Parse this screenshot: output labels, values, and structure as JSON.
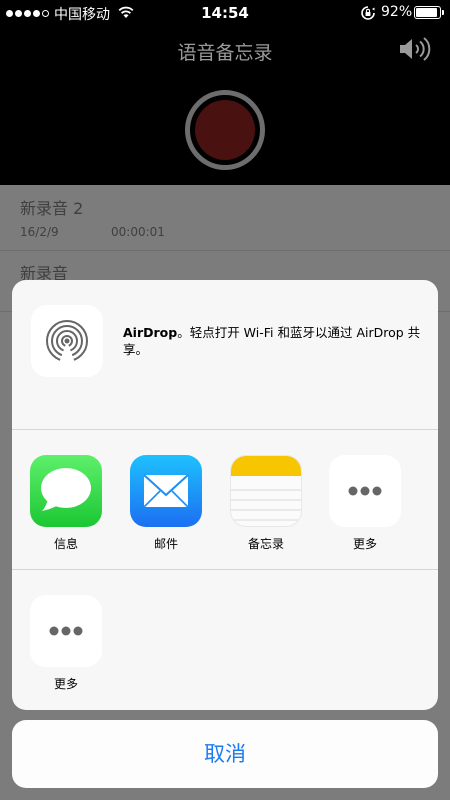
{
  "status_bar": {
    "carrier": "中国移动",
    "time": "14:54",
    "battery": "92%",
    "battery_level": 0.92
  },
  "header": {
    "title": "语音备忘录"
  },
  "recordings": [
    {
      "title": "新录音 2",
      "date": "16/2/9",
      "duration": "00:00:01"
    },
    {
      "title": "新录音"
    }
  ],
  "share_sheet": {
    "airdrop_title": "AirDrop",
    "airdrop_desc": "。轻点打开 Wi-Fi 和蓝牙以通过 AirDrop 共享。",
    "apps": [
      {
        "label": "信息",
        "icon": "messages-icon"
      },
      {
        "label": "邮件",
        "icon": "mail-icon"
      },
      {
        "label": "备忘录",
        "icon": "notes-icon"
      },
      {
        "label": "更多",
        "icon": "more-icon"
      }
    ],
    "actions": [
      {
        "label": "更多",
        "icon": "more-icon"
      }
    ],
    "cancel_label": "取消"
  },
  "colors": {
    "accent": "#1a7cf0",
    "messages_green": "#1bc733",
    "mail_blue": "#1b6ff2",
    "notes_yellow": "#f7c600"
  }
}
